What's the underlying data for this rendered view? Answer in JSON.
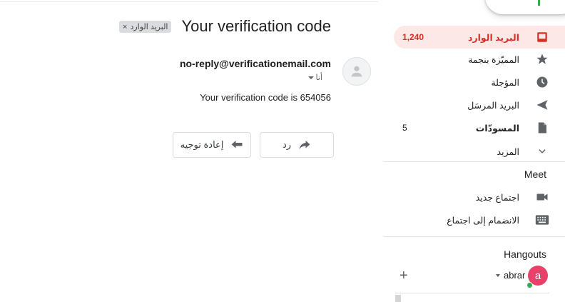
{
  "message": {
    "subject": "Your verification code",
    "label_chip": "البريد الوارد",
    "label_chip_close": "×",
    "sender": "no-reply@verificationemail.com",
    "to_me": "أنا",
    "body": "Your verification code is 654056",
    "reply_label": "رد",
    "forward_label": "إعادة توجيه"
  },
  "sidebar": {
    "items": [
      {
        "label": "البريد الوارد",
        "count": "1,240",
        "icon": "inbox-icon",
        "active": true
      },
      {
        "label": "المميّزة بنجمة",
        "count": "",
        "icon": "star-icon"
      },
      {
        "label": "المؤجلة",
        "count": "",
        "icon": "clock-icon"
      },
      {
        "label": "البريد المرسَل",
        "count": "",
        "icon": "send-icon"
      },
      {
        "label": "المسودّات",
        "count": "5",
        "icon": "draft-icon"
      },
      {
        "label": "المزيد",
        "count": "",
        "icon": "chevron-down-icon"
      }
    ],
    "meet": {
      "title": "Meet",
      "new_meeting": "اجتماع جديد",
      "join_meeting": "الانضمام إلى اجتماع"
    },
    "hangouts": {
      "title": "Hangouts",
      "user_name": "abrar",
      "user_initial": "a"
    }
  },
  "colors": {
    "accent": "#d93025",
    "active_bg": "#fce8e6",
    "avatar": "#e8416a",
    "presence": "#34a853"
  }
}
